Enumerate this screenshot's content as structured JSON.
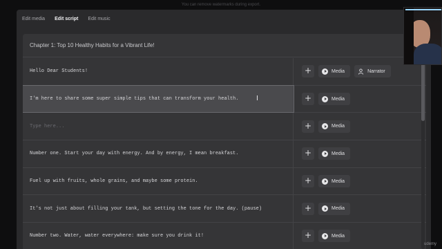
{
  "notice": "You can remove watermarks during export.",
  "tabs": [
    {
      "label": "Edit media"
    },
    {
      "label": "Edit script"
    },
    {
      "label": "Edit music"
    }
  ],
  "chapter": {
    "title": "Chapter 1: Top 10 Healthy Habits for a Vibrant Life!",
    "collapse_icon": "chevron-up-icon"
  },
  "rows": [
    {
      "text": "Hello Dear Students!",
      "media_label": "Media",
      "narrator_label": "Narrator"
    },
    {
      "text": "I'm here to share some super simple tips that can transform your health.",
      "media_label": "Media"
    },
    {
      "placeholder": "Type here...",
      "media_label": "Media"
    },
    {
      "text": "Number one. Start your day with energy. And by energy, I mean breakfast.",
      "media_label": "Media"
    },
    {
      "text": "Fuel up with fruits, whole grains, and maybe some protein.",
      "media_label": "Media"
    },
    {
      "text": "It's not just about filling your tank, but setting the tone for the day. (pause)",
      "media_label": "Media"
    },
    {
      "text": "Number two. Water, water everywhere: make sure you drink it!",
      "media_label": "Media"
    }
  ],
  "add_symbol": "+",
  "watermark": "udemy",
  "colors": {
    "background": "#0e0e0f",
    "app": "#2a2a2c",
    "panel": "#353537",
    "button": "#3f3f42",
    "selected_row": "#4a4a4d"
  }
}
